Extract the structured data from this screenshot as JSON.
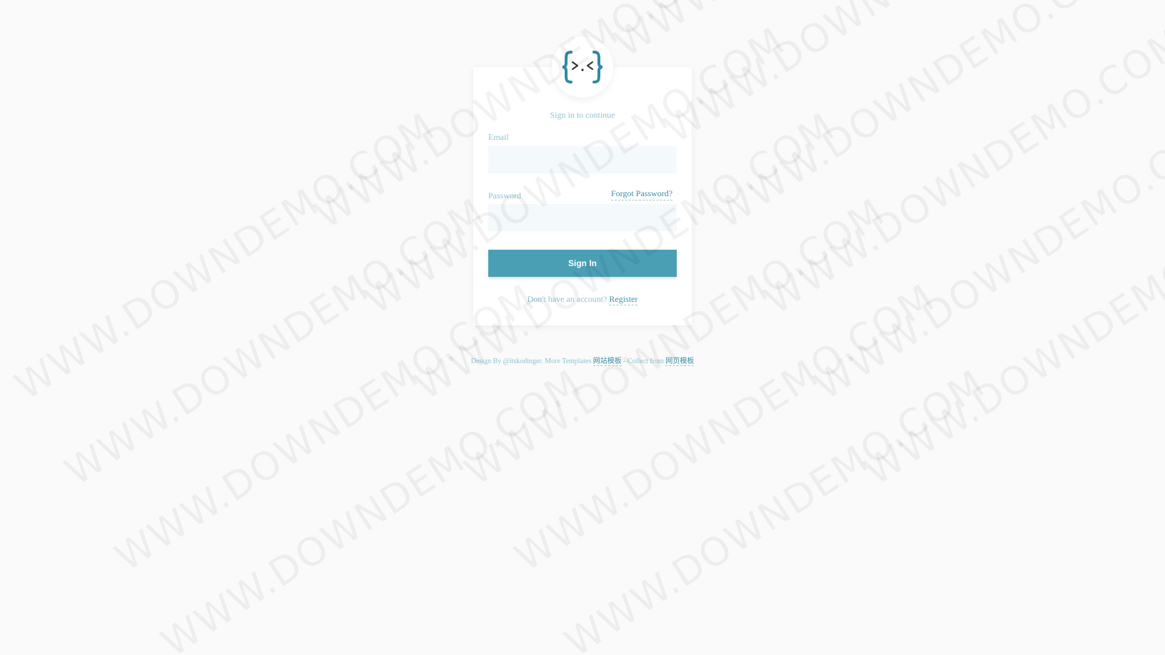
{
  "logo": {
    "glyph": "{>.<}",
    "brand_color": "#2f8aa3",
    "accent_color": "#333333"
  },
  "form": {
    "subtitle": "Sign in to continue",
    "email": {
      "label": "Email",
      "value": "",
      "placeholder": ""
    },
    "password": {
      "label": "Password",
      "value": "",
      "placeholder": ""
    },
    "forgot_password": "Forgot Password?",
    "submit_label": "Sign In",
    "register_prompt": "Don't have an account?",
    "register_link": "Register"
  },
  "footer": {
    "design_by": "Design By @itskodinger. More Templates",
    "templates_link": "网站模板",
    "collect_text": "- Collect from",
    "collect_link": "网页模板"
  },
  "watermark": {
    "text": "WWW.DOWNDEMO.COM"
  },
  "colors": {
    "background": "#fafafa",
    "card": "#ffffff",
    "button": "#4a9fb5",
    "link": "#3a8fa6",
    "label": "#8ec3d1",
    "input_bg": "#f4f9fb"
  }
}
